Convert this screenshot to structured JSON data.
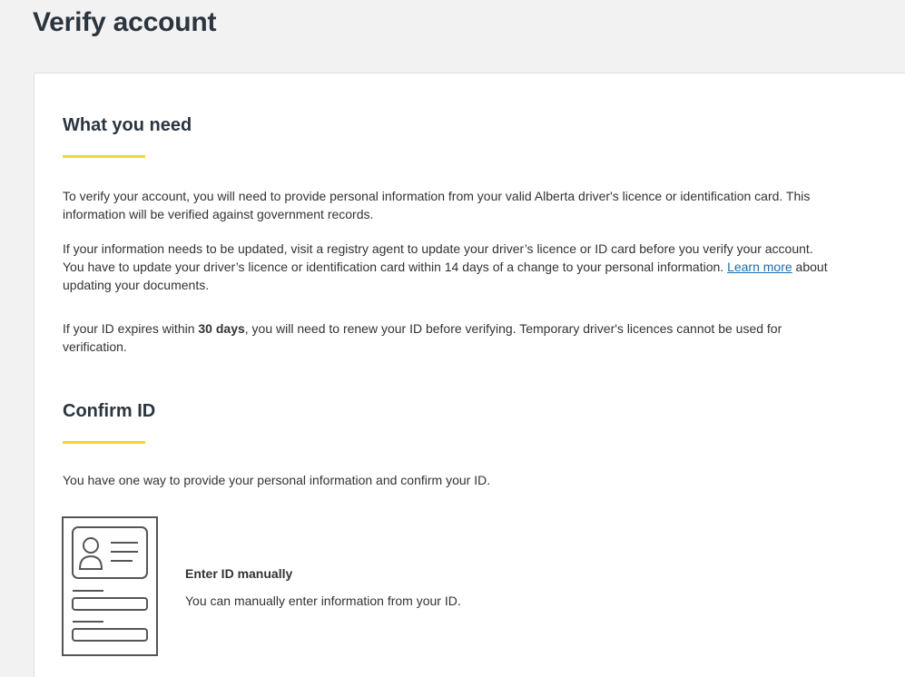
{
  "page": {
    "title": "Verify account"
  },
  "what_you_need": {
    "heading": "What you need",
    "paragraph1": "To verify your account, you will need to provide personal information from your valid Alberta driver's licence or identification card. This information will be verified against government records.",
    "paragraph2_before_link": "If your information needs to be updated, visit a registry agent to update your driver’s licence or ID card before you verify your account. You have to update your driver’s licence or identification card within 14 days of a change to your personal information. ",
    "paragraph2_link": "Learn more",
    "paragraph2_after_link": " about updating your documents.",
    "paragraph3_before_bold": "If your ID expires within ",
    "paragraph3_bold": "30 days",
    "paragraph3_after_bold": ", you will need to renew your ID before verifying. Temporary driver's licences cannot be used for verification."
  },
  "confirm_id": {
    "heading": "Confirm ID",
    "intro": "You have one way to provide your personal information and confirm your ID.",
    "method": {
      "icon": "id-card-icon",
      "title": "Enter ID manually",
      "description": "You can manually enter information from your ID."
    }
  },
  "colors": {
    "accent": "#f4d52a",
    "link": "#1a6fa8",
    "heading": "#2b353f"
  }
}
